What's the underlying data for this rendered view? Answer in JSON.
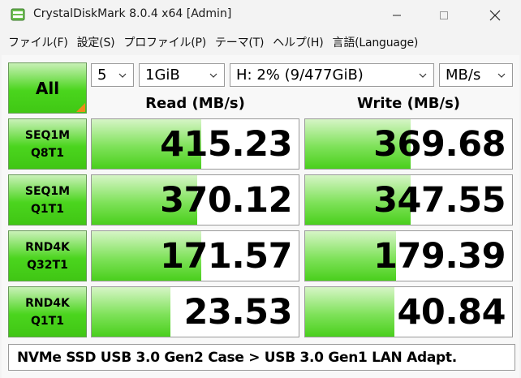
{
  "window": {
    "title": "CrystalDiskMark 8.0.4 x64 [Admin]",
    "app_icon": "disk-icon"
  },
  "menu": [
    "ファイル(F)",
    "設定(S)",
    "プロファイル(P)",
    "テーマ(T)",
    "ヘルプ(H)",
    "言語(Language)"
  ],
  "controls": {
    "all_label": "All",
    "count": "5",
    "size": "1GiB",
    "drive": "H: 2% (9/477GiB)",
    "unit": "MB/s"
  },
  "headers": {
    "read": "Read (MB/s)",
    "write": "Write (MB/s)"
  },
  "tests": [
    {
      "line1": "SEQ1M",
      "line2": "Q8T1",
      "read": "415.23",
      "write": "369.68",
      "read_fill": 0.53,
      "write_fill": 0.51
    },
    {
      "line1": "SEQ1M",
      "line2": "Q1T1",
      "read": "370.12",
      "write": "347.55",
      "read_fill": 0.51,
      "write_fill": 0.51
    },
    {
      "line1": "RND4K",
      "line2": "Q32T1",
      "read": "171.57",
      "write": "179.39",
      "read_fill": 0.53,
      "write_fill": 0.44
    },
    {
      "line1": "RND4K",
      "line2": "Q1T1",
      "read": "23.53",
      "write": "40.84",
      "read_fill": 0.38,
      "write_fill": 0.43
    }
  ],
  "comment": "NVMe SSD USB 3.0 Gen2 Case > USB 3.0 Gen1 LAN Adapt.",
  "colors": {
    "accent_green": "#4ad51d",
    "corner_orange": "#f28a1c"
  }
}
